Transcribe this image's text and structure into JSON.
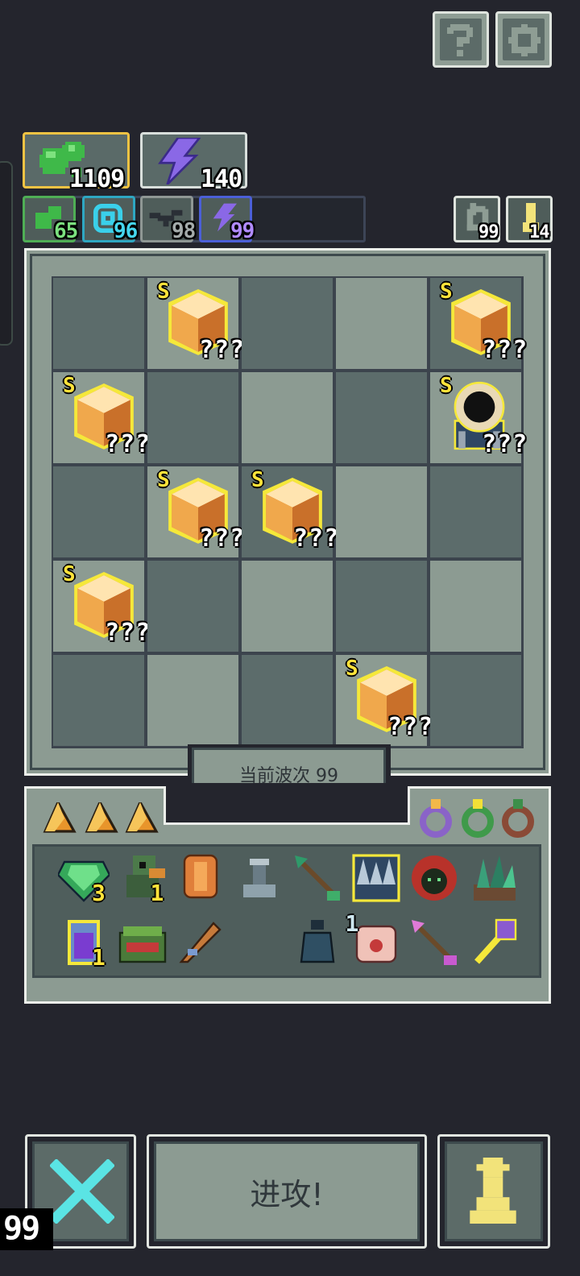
{
  "top_buttons": {
    "help_icon": "question-icon",
    "settings_icon": "gear-icon"
  },
  "resources": {
    "gold": "1109",
    "energy": "140"
  },
  "stats": [
    {
      "icon": "green-blob-icon",
      "value": "65",
      "color": "#5ed16a"
    },
    {
      "icon": "spiral-icon",
      "value": "96",
      "color": "#35c8e0"
    },
    {
      "icon": "bird-icon",
      "value": "98",
      "color": "#9aa3a0"
    },
    {
      "icon": "lightning-icon",
      "value": "99",
      "color": "#a17ef0"
    }
  ],
  "mini_buttons": [
    {
      "icon": "refresh-icon",
      "value": "99"
    },
    {
      "icon": "pawn-icon",
      "value": "14"
    }
  ],
  "board": {
    "wave_label": "当前波次 99",
    "rank_label": "S",
    "unknown_label": "???",
    "cells": [
      [
        "",
        "gem",
        "",
        "",
        "gem"
      ],
      [
        "gem",
        "",
        "",
        "",
        "eye"
      ],
      [
        "",
        "gem",
        "gem",
        "",
        ""
      ],
      [
        "gem",
        "",
        "",
        "",
        ""
      ],
      [
        "",
        "",
        "",
        "gem",
        ""
      ]
    ]
  },
  "inventory": {
    "tabs": [
      "shard-icon",
      "shard-icon",
      "shard-icon"
    ],
    "rings": [
      "ring-purple-icon",
      "ring-green-icon",
      "ring-brown-icon"
    ],
    "items": [
      {
        "icon": "emerald-icon",
        "count": "3"
      },
      {
        "icon": "goblin-icon",
        "count": "1"
      },
      {
        "icon": "armor-icon",
        "count": ""
      },
      {
        "icon": "anvil-icon",
        "count": ""
      },
      {
        "icon": "green-arrow-icon",
        "count": ""
      },
      {
        "icon": "crystal-crown-icon",
        "count": ""
      },
      {
        "icon": "hood-icon",
        "count": ""
      },
      {
        "icon": "crystal-cluster-icon",
        "count": ""
      },
      {
        "icon": "potion-icon",
        "count": "1"
      },
      {
        "icon": "chest-mimic-icon",
        "count": ""
      },
      {
        "icon": "feather-icon",
        "count": ""
      },
      {
        "icon": "empty-icon",
        "count": ""
      },
      {
        "icon": "bell-icon",
        "count": ""
      },
      {
        "icon": "eye-hand-icon",
        "count": "1"
      },
      {
        "icon": "pink-arrow-icon",
        "count": ""
      },
      {
        "icon": "staff-icon",
        "count": ""
      }
    ]
  },
  "bottom": {
    "attack_label": "进攻!",
    "corner_number": "99"
  }
}
